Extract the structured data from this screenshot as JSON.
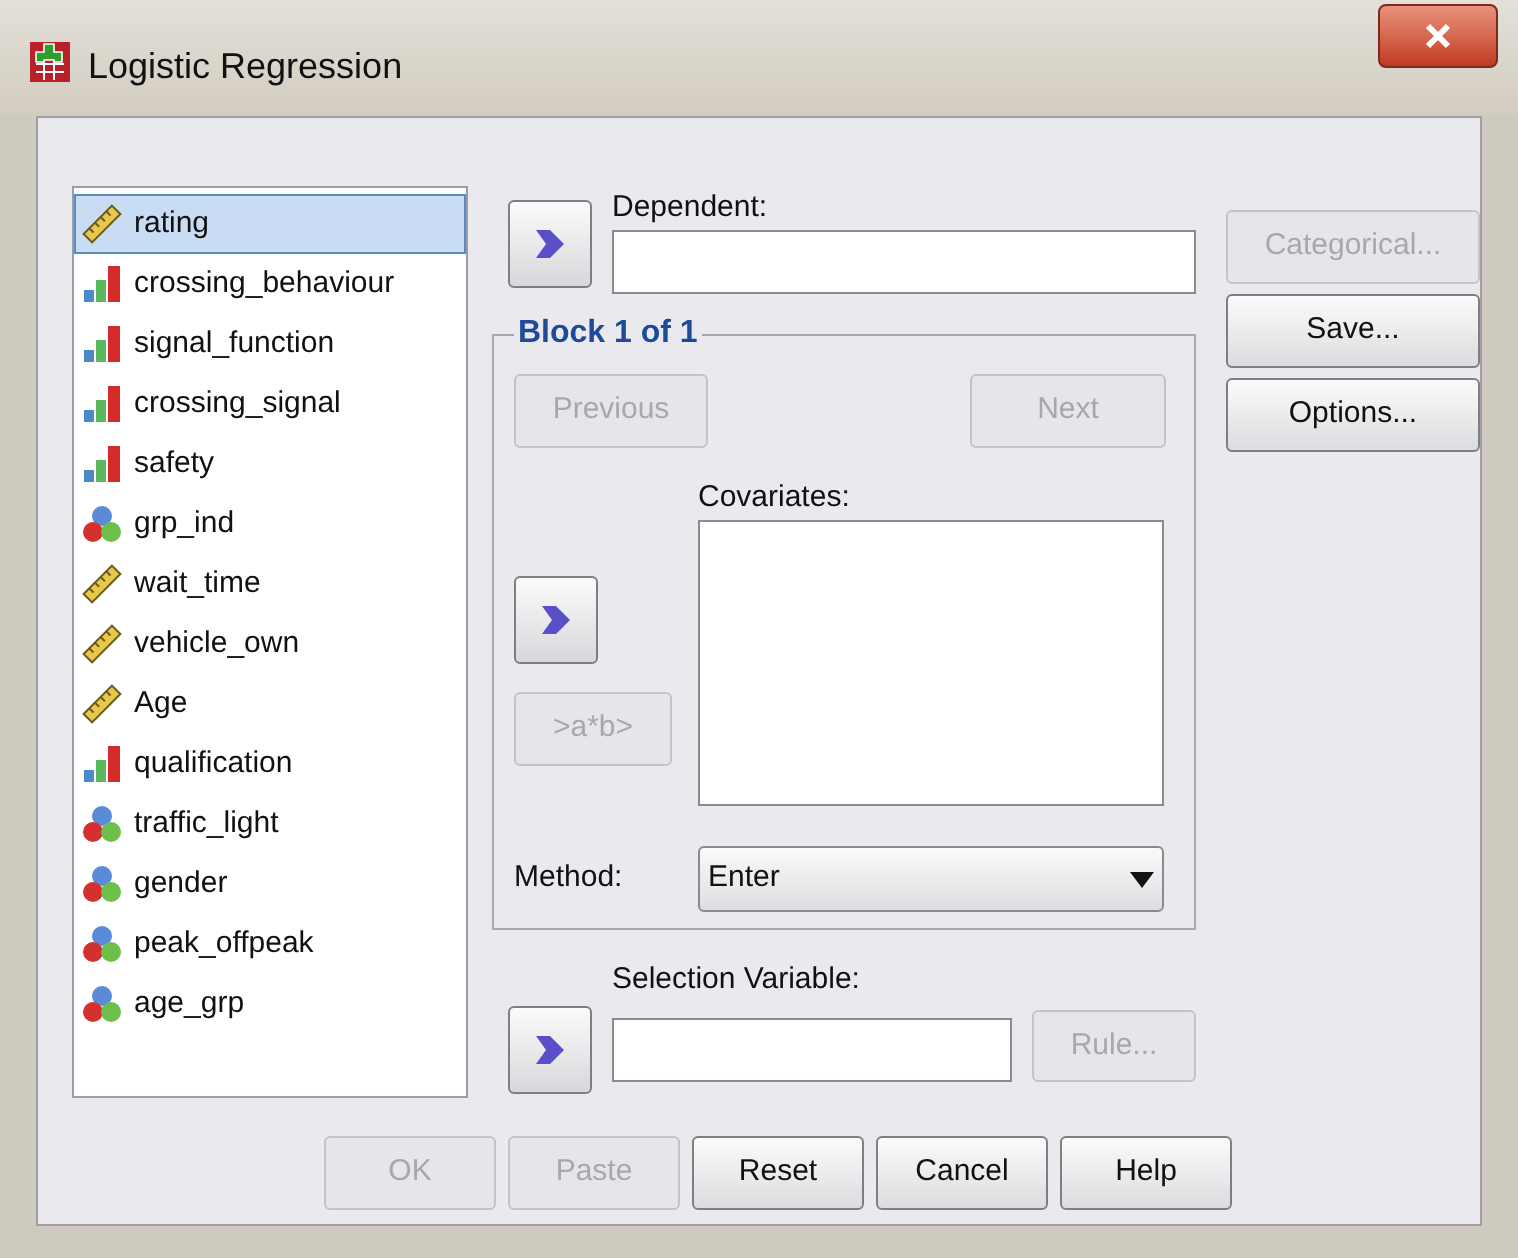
{
  "window": {
    "title": "Logistic Regression"
  },
  "variables": [
    {
      "name": "rating",
      "kind": "scale",
      "selected": true
    },
    {
      "name": "crossing_behaviour",
      "kind": "ordinal",
      "selected": false
    },
    {
      "name": "signal_function",
      "kind": "ordinal",
      "selected": false
    },
    {
      "name": "crossing_signal",
      "kind": "ordinal",
      "selected": false
    },
    {
      "name": "safety",
      "kind": "ordinal",
      "selected": false
    },
    {
      "name": "grp_ind",
      "kind": "nominal",
      "selected": false
    },
    {
      "name": "wait_time",
      "kind": "scale",
      "selected": false
    },
    {
      "name": "vehicle_own",
      "kind": "scale",
      "selected": false
    },
    {
      "name": "Age",
      "kind": "scale",
      "selected": false
    },
    {
      "name": "qualification",
      "kind": "ordinal",
      "selected": false
    },
    {
      "name": "traffic_light",
      "kind": "nominal",
      "selected": false
    },
    {
      "name": "gender",
      "kind": "nominal",
      "selected": false
    },
    {
      "name": "peak_offpeak",
      "kind": "nominal",
      "selected": false
    },
    {
      "name": "age_grp",
      "kind": "nominal",
      "selected": false
    }
  ],
  "dependent": {
    "label": "Dependent:"
  },
  "block": {
    "title": "Block 1 of 1",
    "previous": {
      "label": "Previous",
      "disabled": true
    },
    "next": {
      "label": "Next",
      "disabled": true
    },
    "covariates_label": "Covariates:",
    "interaction": {
      "label": ">a*b>",
      "disabled": true
    },
    "method_label": "Method:",
    "method_value": "Enter"
  },
  "selection": {
    "label": "Selection Variable:",
    "rule": {
      "label": "Rule...",
      "disabled": true
    }
  },
  "side_buttons": [
    {
      "label": "Categorical...",
      "disabled": true
    },
    {
      "label": "Save...",
      "disabled": false
    },
    {
      "label": "Options...",
      "disabled": false
    }
  ],
  "bottom_buttons": [
    {
      "label": "OK",
      "disabled": true
    },
    {
      "label": "Paste",
      "disabled": true
    },
    {
      "label": "Reset",
      "disabled": false
    },
    {
      "label": "Cancel",
      "disabled": false
    },
    {
      "label": "Help",
      "disabled": false
    }
  ]
}
